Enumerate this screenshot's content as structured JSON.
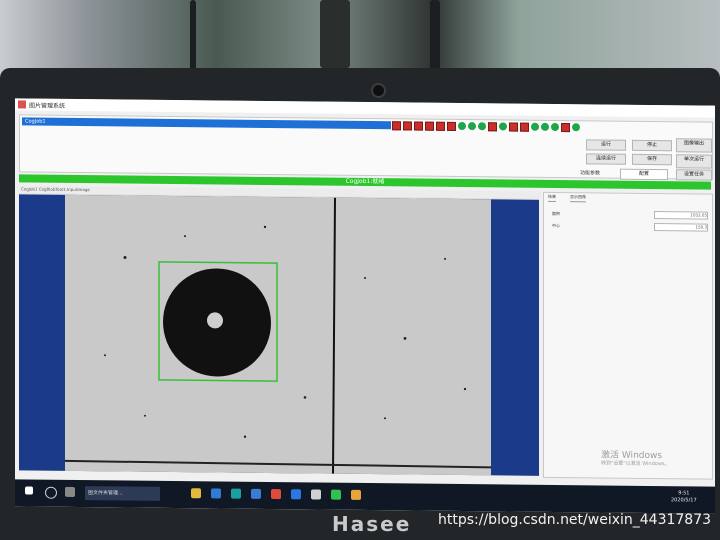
{
  "app": {
    "window_title": "图片管理系统",
    "job_bar_text": "CogJob1",
    "status_text": "CogJob1:就绪",
    "viewer_caption": "CogJob1 CogBlobTool1.InputImage"
  },
  "toolbar": {
    "buttons": [
      "运行",
      "停止",
      "连续运行",
      "保存",
      "图像输出",
      "单次运行"
    ],
    "select_label": "功能参数",
    "select_value": "配置",
    "link_label": "设置任务"
  },
  "right_panel": {
    "tabs": [
      "结果",
      "显示图像"
    ],
    "fields": [
      {
        "label": "面积",
        "value": "1032.05"
      },
      {
        "label": "中心",
        "value": "150.3"
      }
    ]
  },
  "windows": {
    "activate_title": "激活 Windows",
    "activate_hint": "转到\"设置\"以激活 Windows。"
  },
  "taskbar": {
    "task_label": "图文件夹管理...",
    "clock_time": "9:51",
    "clock_date": "2020/5/17"
  },
  "device": {
    "brand": "Hasee",
    "watermark": "https://blog.csdn.net/weixin_44317873"
  },
  "colors": {
    "status_green": "#2cc52c",
    "job_blue": "#1e6fd6",
    "image_blue": "#1b3a8a"
  }
}
